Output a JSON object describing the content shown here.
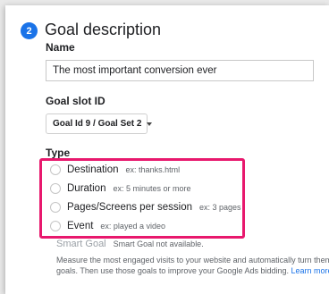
{
  "step": {
    "number": "2",
    "title": "Goal description"
  },
  "name": {
    "label": "Name",
    "value": "The most important conversion ever"
  },
  "goal_slot": {
    "label": "Goal slot ID",
    "selected": "Goal Id 9 / Goal Set 2"
  },
  "type": {
    "label": "Type",
    "options": [
      {
        "label": "Destination",
        "hint": "ex: thanks.html",
        "selected": false
      },
      {
        "label": "Duration",
        "hint": "ex: 5 minutes or more",
        "selected": false
      },
      {
        "label": "Pages/Screens per session",
        "hint": "ex: 3 pages",
        "selected": false
      },
      {
        "label": "Event",
        "hint": "ex: played a video",
        "selected": false
      }
    ]
  },
  "smart_goal": {
    "label": "Smart Goal",
    "note": "Smart Goal not available.",
    "description": "Measure the most engaged visits to your website and automatically turn them into goals. Then use those goals to improve your Google Ads bidding.",
    "link": "Learn more"
  },
  "colors": {
    "accent": "#1a73e8",
    "highlight": "#e8186d"
  }
}
